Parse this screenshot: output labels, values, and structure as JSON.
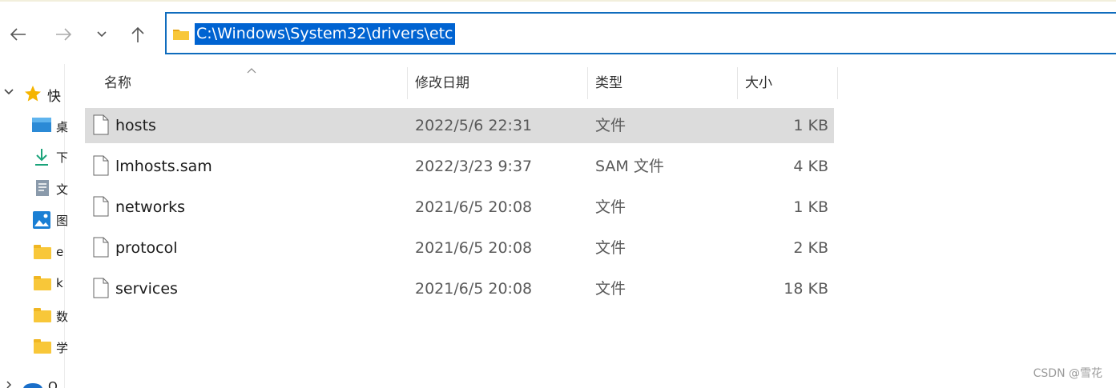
{
  "window": {
    "accent": "#0063d1",
    "selection_bg": "#dcdcdc"
  },
  "address_bar": {
    "path": "C:\\Windows\\System32\\drivers\\etc",
    "icon": "folder-icon"
  },
  "nav_buttons": [
    {
      "name": "back",
      "icon": "arrow-left-icon"
    },
    {
      "name": "forward",
      "icon": "arrow-right-icon"
    },
    {
      "name": "recent",
      "icon": "chevron-down-icon"
    },
    {
      "name": "up",
      "icon": "arrow-up-icon"
    }
  ],
  "nav_pane": {
    "quick_access_label": "快",
    "items": [
      {
        "icon": "desktop-icon",
        "label": "桌"
      },
      {
        "icon": "download-icon",
        "label": "下"
      },
      {
        "icon": "document-icon",
        "label": "文"
      },
      {
        "icon": "picture-icon",
        "label": "图"
      },
      {
        "icon": "folder-icon",
        "label": "e"
      },
      {
        "icon": "folder-icon",
        "label": "k"
      },
      {
        "icon": "folder-icon",
        "label": "数"
      },
      {
        "icon": "folder-icon",
        "label": "学"
      }
    ],
    "bottom_item_label": "O"
  },
  "columns": {
    "name": "名称",
    "date": "修改日期",
    "type": "类型",
    "size": "大小"
  },
  "files": [
    {
      "name": "hosts",
      "date": "2022/5/6 22:31",
      "type": "文件",
      "size": "1 KB",
      "selected": true
    },
    {
      "name": "lmhosts.sam",
      "date": "2022/3/23 9:37",
      "type": "SAM 文件",
      "size": "4 KB",
      "selected": false
    },
    {
      "name": "networks",
      "date": "2021/6/5 20:08",
      "type": "文件",
      "size": "1 KB",
      "selected": false
    },
    {
      "name": "protocol",
      "date": "2021/6/5 20:08",
      "type": "文件",
      "size": "2 KB",
      "selected": false
    },
    {
      "name": "services",
      "date": "2021/6/5 20:08",
      "type": "文件",
      "size": "18 KB",
      "selected": false
    }
  ],
  "watermark": "CSDN @雪花"
}
